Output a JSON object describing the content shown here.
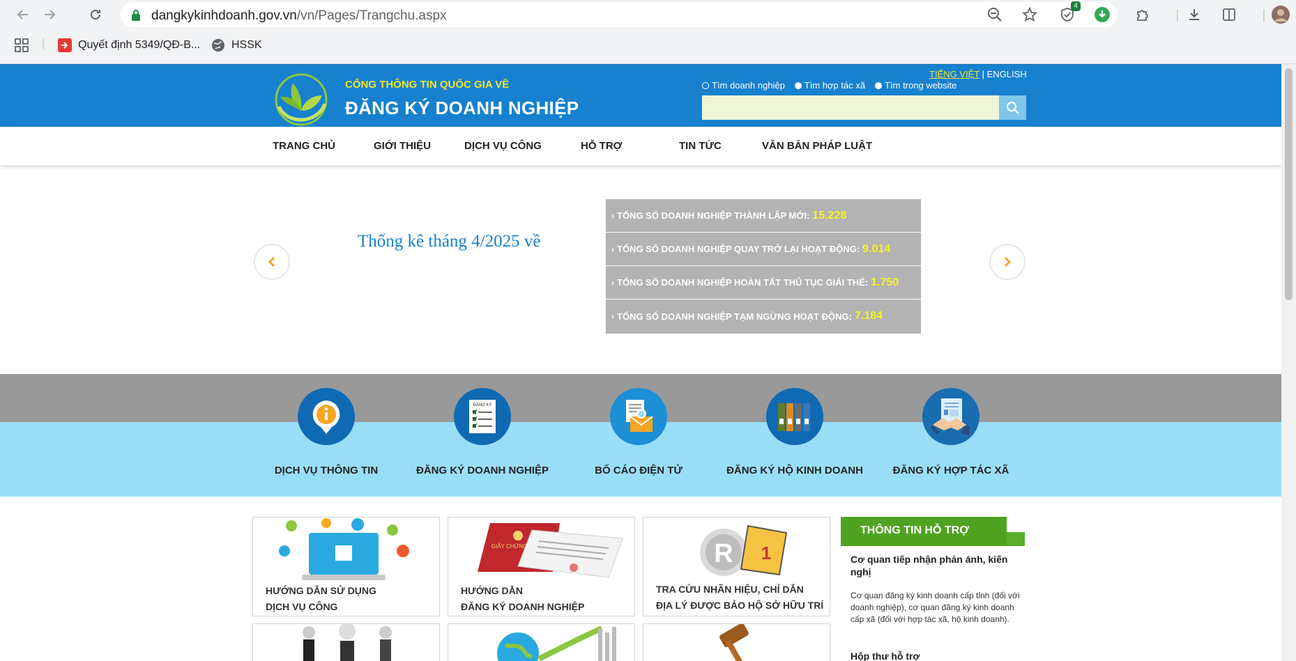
{
  "browser": {
    "url_domain": "dangkykinhdoanh.gov.vn",
    "url_path": "/vn/Pages/Trangchu.aspx",
    "extension_badge": "4",
    "bookmarks": [
      {
        "label": "Quyết định 5349/QĐ-B..."
      },
      {
        "label": "HSSK"
      }
    ]
  },
  "header": {
    "subtitle": "CỔNG THÔNG TIN QUỐC GIA VỀ",
    "title": "ĐĂNG KÝ DOANH NGHIỆP",
    "lang_vi": "TIẾNG VIỆT",
    "lang_sep": "|",
    "lang_en": "ENGLISH",
    "search_options": [
      "Tìm doanh nghiệp",
      "Tìm hợp tác xã",
      "Tìm trong website"
    ]
  },
  "nav": [
    "TRANG CHỦ",
    "GIỚI THIỆU",
    "DỊCH VỤ CÔNG",
    "HỖ TRỢ",
    "TIN TỨC",
    "VĂN BẢN PHÁP LUẬT"
  ],
  "stats": {
    "heading": "Thống kê tháng 4/2025 về",
    "rows": [
      {
        "label": "TỔNG SỐ DOANH NGHIỆP THÀNH LẬP MỚI:",
        "value": "15.228"
      },
      {
        "label": "TỔNG SỐ DOANH NGHIỆP QUAY TRỞ LẠI HOẠT ĐỘNG:",
        "value": "9.014"
      },
      {
        "label": "TỔNG SỐ DOANH NGHIỆP HOÀN TẤT THỦ TỤC GIẢI THỂ:",
        "value": "1.750"
      },
      {
        "label": "TỔNG SỐ DOANH NGHIỆP TẠM NGỪNG HOẠT ĐỘNG:",
        "value": "7.184"
      }
    ]
  },
  "services": [
    "DỊCH VỤ THÔNG TIN",
    "ĐĂNG KÝ DOANH NGHIỆP",
    "BỐ CÁO ĐIỆN TỬ",
    "ĐĂNG KÝ HỘ KINH DOANH",
    "ĐĂNG KÝ HỢP TÁC XÃ"
  ],
  "cards": [
    {
      "line1": "HƯỚNG DẪN SỬ DỤNG",
      "line2": "DỊCH VỤ CÔNG"
    },
    {
      "line1": "HƯỚNG DẪN",
      "line2": "ĐĂNG KÝ DOANH NGHIỆP"
    },
    {
      "line1": "TRA CỨU NHÃN HIỆU, CHỈ DẪN",
      "line2": "ĐỊA LÝ ĐƯỢC BẢO HỘ SỞ HỮU TRÍ TUỆ"
    }
  ],
  "support": {
    "heading": "THÔNG TIN HỖ TRỢ",
    "question": "Cơ quan tiếp nhận phản ánh, kiến nghị",
    "answer": "Cơ quan đăng ký kinh doanh cấp tỉnh (đối với doanh nghiệp), cơ quan đăng ký kinh doanh cấp xã (đối với hợp tác xã, hộ kinh doanh).",
    "mailbox": "Hộp thư hỗ trợ"
  },
  "colors": {
    "header_blue": "#1781cf",
    "accent_yellow": "#f2e52e",
    "support_green": "#4fa321",
    "band_blue": "#99def9"
  }
}
